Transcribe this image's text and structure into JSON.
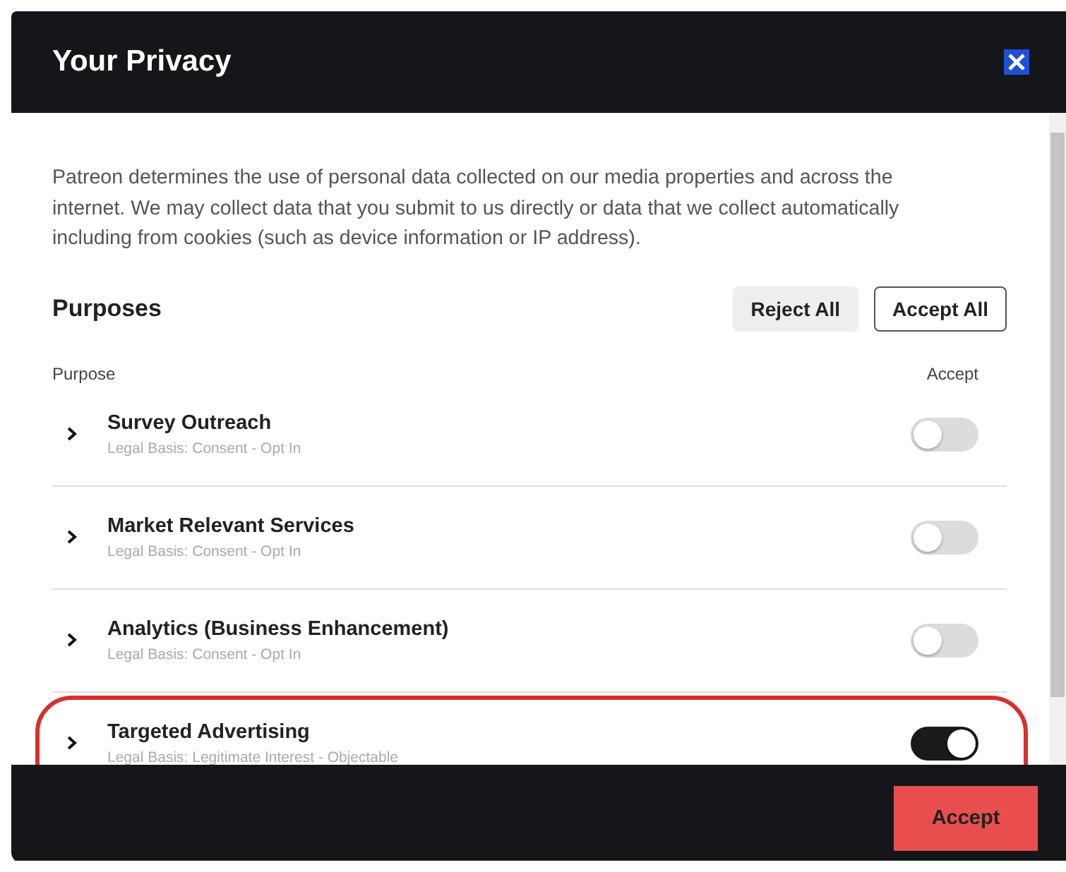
{
  "dialog": {
    "title": "Your Privacy",
    "description": "Patreon determines the use of personal data collected on our media properties and across the internet. We may collect data that you submit to us directly or data that we collect automatically including from cookies (such as device information or IP address).",
    "section_title": "Purposes",
    "reject_all": "Reject All",
    "accept_all": "Accept All",
    "columns": [
      "Purpose",
      "Accept"
    ],
    "purposes": [
      {
        "name": "Survey Outreach",
        "legal_basis": "Legal Basis: Consent - Opt In",
        "on": false,
        "highlighted": false
      },
      {
        "name": "Market Relevant Services",
        "legal_basis": "Legal Basis: Consent - Opt In",
        "on": false,
        "highlighted": false
      },
      {
        "name": "Analytics (Business Enhancement)",
        "legal_basis": "Legal Basis: Consent - Opt In",
        "on": false,
        "highlighted": false
      },
      {
        "name": "Targeted Advertising",
        "legal_basis": "Legal Basis: Legitimate Interest - Objectable",
        "on": true,
        "highlighted": true
      }
    ],
    "accept_button": "Accept"
  }
}
